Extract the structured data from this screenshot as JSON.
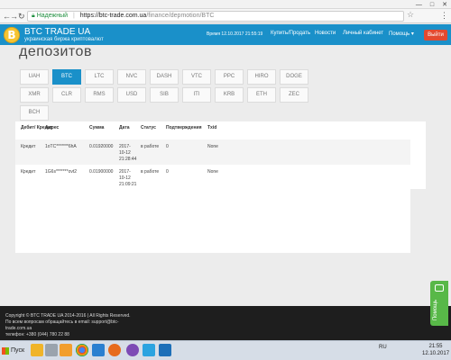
{
  "browser": {
    "back_glyph": "←",
    "forward_glyph": "→",
    "reload_glyph": "↻",
    "secure_label": "Надежный",
    "url_host": "https://btc-trade.com.ua",
    "url_path": "/finance/depmotion/BTC",
    "star_glyph": "☆",
    "menu_glyph": "⋮",
    "window_controls": [
      "—",
      "□",
      "✕"
    ]
  },
  "header": {
    "logo_letter": "B",
    "brand_name": "BTC TRADE UA",
    "brand_subtitle": "украинская биржа криптовалют",
    "time_text": "Время 12.10.2017 21:55:19",
    "nav_buy_sell": "Купить/Продать",
    "nav_news": "Новости",
    "nav_cabinet": "Личный кабинет",
    "nav_help": "Помощь ▾",
    "exit_label": "Выйти"
  },
  "page": {
    "title": "депозитов"
  },
  "currency_tabs": [
    "UAH",
    "BTC",
    "LTC",
    "NVC",
    "DASH",
    "VTC",
    "PPC",
    "HIRO",
    "DOGE",
    "XMR",
    "CLR",
    "RMS",
    "USD",
    "SIB",
    "ITI",
    "KRB",
    "ETH",
    "ZEC",
    "BCH"
  ],
  "active_tab": "BTC",
  "table": {
    "headers": {
      "type": "Дебит/ Кредит",
      "address": "Адрес",
      "amount": "Сумма",
      "date": "Дата",
      "status": "Статус",
      "confirmations": "Подтверждения",
      "txid": "Txid"
    },
    "rows": [
      {
        "type": "Кредит",
        "address": "1oTC*******6hA",
        "amount": "0.01920000",
        "date_line1": "2017-",
        "date_line2": "10-12",
        "date_line3": "21:28:44",
        "status": "в работе",
        "confirmations": "0",
        "txid": "None"
      },
      {
        "type": "Кредит",
        "address": "1G6s*******ovt2",
        "amount": "0.01900000",
        "date_line1": "2017-",
        "date_line2": "10-12",
        "date_line3": "21:09:21",
        "status": "в работе",
        "confirmations": "0",
        "txid": "None"
      }
    ]
  },
  "footer": {
    "line1": "Copyright © BTC TRADE UA 2014-2016 | All Rights Reserved.",
    "line2": "По всем вопросам обращайтесь в email: support@btc-",
    "line3": "trade.com.ua",
    "line4": "телефон: +380 (044) 780 22 88"
  },
  "help_widget": {
    "label": "Помощь"
  },
  "taskbar": {
    "start_label": "Пуск",
    "lang": "RU",
    "time": "21:55",
    "date": "12.10.2017"
  },
  "colors": {
    "brand_blue": "#1a90c9",
    "exit_red": "#e3492f",
    "help_green": "#58b848",
    "footer_dark": "#1e1e1e"
  }
}
